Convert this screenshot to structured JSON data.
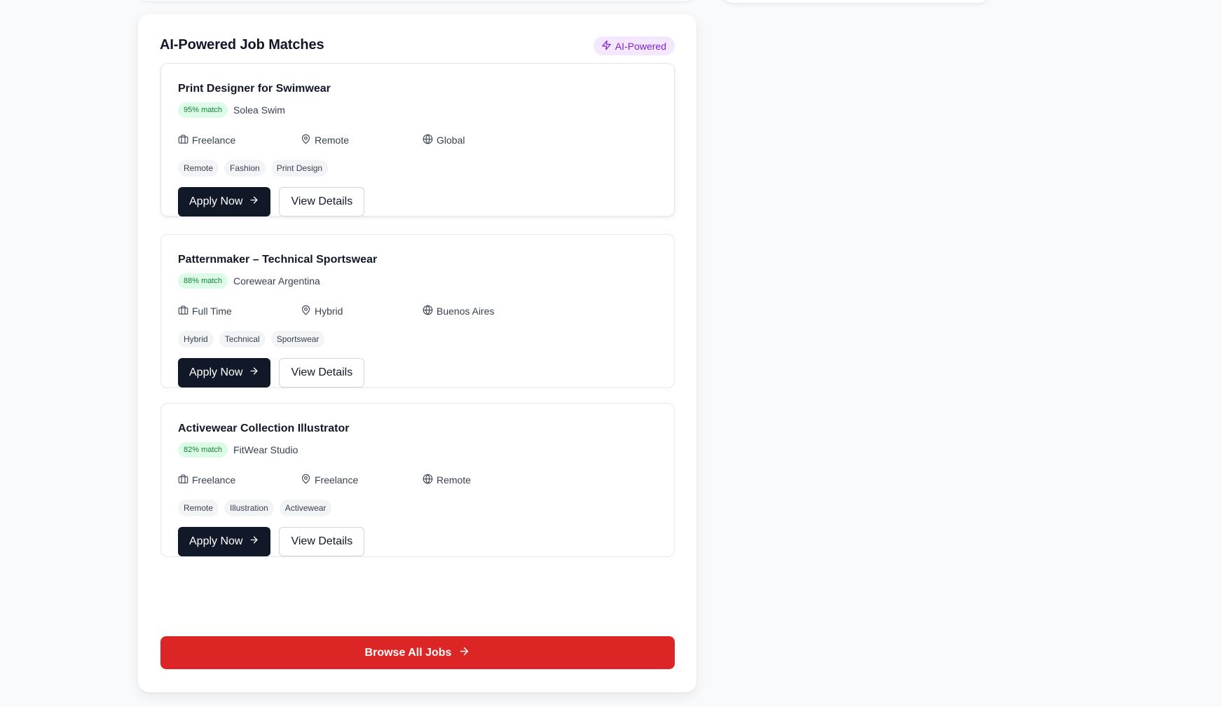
{
  "panel": {
    "title": "AI-Powered Job Matches",
    "badge_label": "AI-Powered",
    "badge_icon": "lightning-icon"
  },
  "jobs": [
    {
      "title": "Print Designer for Swimwear",
      "match": "95% match",
      "company": "Solea Swim",
      "type": "Freelance",
      "work_mode": "Remote",
      "region": "Global",
      "tags": [
        "Remote",
        "Fashion",
        "Print Design"
      ],
      "apply_label": "Apply Now",
      "details_label": "View Details"
    },
    {
      "title": "Patternmaker – Technical Sportswear",
      "match": "88% match",
      "company": "Corewear Argentina",
      "type": "Full Time",
      "work_mode": "Hybrid",
      "region": "Buenos Aires",
      "tags": [
        "Hybrid",
        "Technical",
        "Sportswear"
      ],
      "apply_label": "Apply Now",
      "details_label": "View Details"
    },
    {
      "title": "Activewear Collection Illustrator",
      "match": "82% match",
      "company": "FitWear Studio",
      "type": "Freelance",
      "work_mode": "Freelance",
      "region": "Remote",
      "tags": [
        "Remote",
        "Illustration",
        "Activewear"
      ],
      "apply_label": "Apply Now",
      "details_label": "View Details"
    }
  ],
  "browse": {
    "label": "Browse All Jobs"
  },
  "colors": {
    "primary_dark": "#111827",
    "accent_red": "#dc2626",
    "match_green_bg": "#dcfce7",
    "match_green_text": "#15803d",
    "ai_purple_bg": "#f3e8ff",
    "ai_purple_text": "#7e22ce"
  }
}
